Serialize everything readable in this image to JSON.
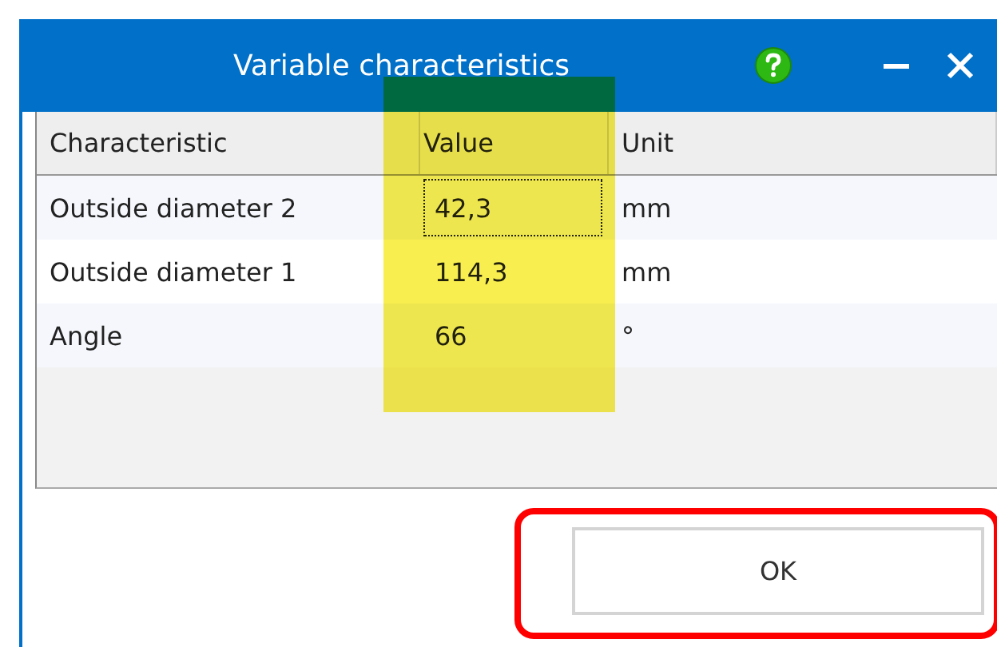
{
  "window": {
    "title": "Variable characteristics"
  },
  "table": {
    "columns": [
      "Characteristic",
      "Value",
      "Unit"
    ],
    "rows": [
      {
        "characteristic": "Outside diameter 2",
        "value": "42,3",
        "unit": "mm",
        "focused": true
      },
      {
        "characteristic": "Outside diameter 1",
        "value": "114,3",
        "unit": "mm",
        "focused": false
      },
      {
        "characteristic": "Angle",
        "value": "66",
        "unit": "°",
        "focused": false
      }
    ]
  },
  "buttons": [
    "OK"
  ]
}
